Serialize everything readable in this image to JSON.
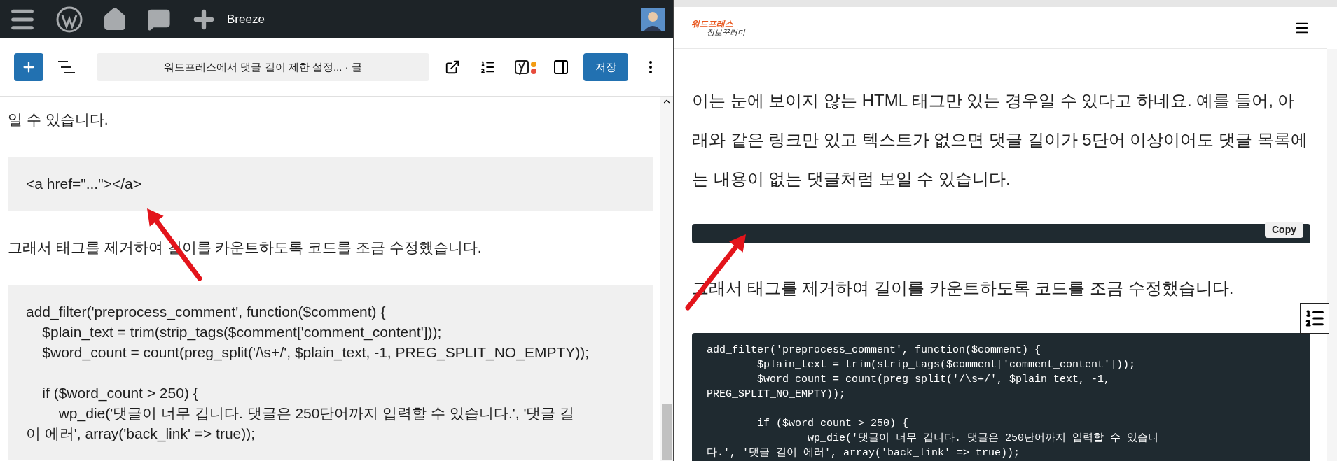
{
  "admin_bar": {
    "site_name": "Breeze"
  },
  "editor_toolbar": {
    "document_title": "워드프레스에서 댓글 길이 제한 설정... · 글",
    "save_button": "저장"
  },
  "editor_content": [
    {
      "kind": "paragraph",
      "text": "일 수 있습니다."
    },
    {
      "kind": "code",
      "text": "<a href=\"...\"></a>"
    },
    {
      "kind": "paragraph",
      "text": "그래서 태그를 제거하여 길이를 카운트하도록 코드를 조금 수정했습니다."
    },
    {
      "kind": "code",
      "text": "add_filter('preprocess_comment', function($comment) {\n\t$plain_text = trim(strip_tags($comment['comment_content']));\n\t$word_count = count(preg_split('/\\s+/', $plain_text, -1, PREG_SPLIT_NO_EMPTY));\n\n\tif ($word_count > 250) {\n\t\twp_die('댓글이 너무 깁니다. 댓글은 250단어까지 입력할 수 있습니다.', '댓글 길\n이 에러', array('back_link' => true));"
    }
  ],
  "preview": {
    "logo": {
      "line_1": "워드프레스",
      "line_2": "정보꾸러미"
    },
    "content": [
      {
        "kind": "paragraph",
        "text": "이는 눈에 보이지 않는 HTML 태그만 있는 경우일 수 있다고 하네요. 예를 들어, 아래와 같은 링크만 있고 텍스트가 없으면 댓글 길이가 5단어 이상이어도 댓글 목록에는 내용이 없는 댓글처럼 보일 수 있습니다."
      },
      {
        "kind": "code",
        "copy_button": "Copy"
      },
      {
        "kind": "paragraph",
        "text": "그래서 태그를 제거하여 길이를 카운트하도록 코드를 조금 수정했습니다."
      },
      {
        "kind": "code",
        "text": "add_filter('preprocess_comment', function($comment) {\n\t$plain_text = trim(strip_tags($comment['comment_content']));\n\t$word_count = count(preg_split('/\\s+/', $plain_text, -1,\nPREG_SPLIT_NO_EMPTY));\n\n\tif ($word_count > 250) {\n\t\twp_die('댓글이 너무 깁니다. 댓글은 250단어까지 입력할 수 있습니\n다.', '댓글 길이 에러', array('back_link' => true));"
      }
    ]
  }
}
